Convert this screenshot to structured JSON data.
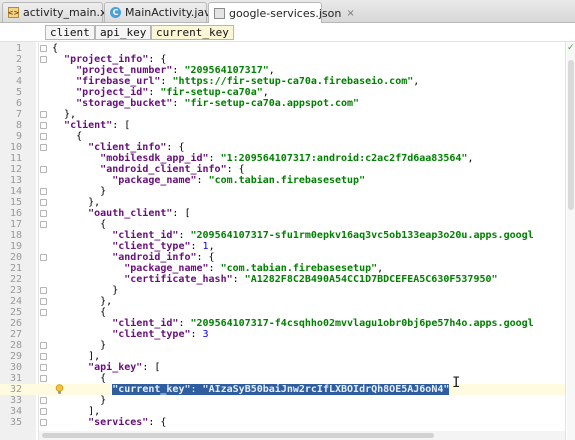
{
  "tabs": [
    {
      "label": "activity_main.xml",
      "icon": "xml-file-icon",
      "active": false
    },
    {
      "label": "MainActivity.java",
      "icon": "java-class-icon",
      "active": false
    },
    {
      "label": "google-services.json",
      "icon": "json-file-icon",
      "active": true
    }
  ],
  "tab_close_glyph": "×",
  "breadcrumb": [
    "client",
    "api_key",
    "current_key"
  ],
  "editor": {
    "lines": [
      {
        "n": "1",
        "code": "{"
      },
      {
        "n": "2",
        "code": "  \"project_info\": {"
      },
      {
        "n": "3",
        "code": "    \"project_number\": \"209564107317\","
      },
      {
        "n": "4",
        "code": "    \"firebase_url\": \"https://fir-setup-ca70a.firebaseio.com\","
      },
      {
        "n": "5",
        "code": "    \"project_id\": \"fir-setup-ca70a\","
      },
      {
        "n": "6",
        "code": "    \"storage_bucket\": \"fir-setup-ca70a.appspot.com\""
      },
      {
        "n": "7",
        "code": "  },"
      },
      {
        "n": "8",
        "code": "  \"client\": ["
      },
      {
        "n": "9",
        "code": "    {"
      },
      {
        "n": "10",
        "code": "      \"client_info\": {"
      },
      {
        "n": "11",
        "code": "        \"mobilesdk_app_id\": \"1:209564107317:android:c2ac2f7d6aa83564\","
      },
      {
        "n": "12",
        "code": "        \"android_client_info\": {"
      },
      {
        "n": "13",
        "code": "          \"package_name\": \"com.tabian.firebasesetup\""
      },
      {
        "n": "14",
        "code": "        }"
      },
      {
        "n": "15",
        "code": "      },"
      },
      {
        "n": "16",
        "code": "      \"oauth_client\": ["
      },
      {
        "n": "17",
        "code": "        {"
      },
      {
        "n": "18",
        "code": "          \"client_id\": \"209564107317-sfu1rm0epkv16aq3vc5ob133eap3o20u.apps.googl"
      },
      {
        "n": "19",
        "code": "          \"client_type\": 1,"
      },
      {
        "n": "20",
        "code": "          \"android_info\": {"
      },
      {
        "n": "21",
        "code": "            \"package_name\": \"com.tabian.firebasesetup\","
      },
      {
        "n": "22",
        "code": "            \"certificate_hash\": \"A1282F8C2B490A54CC1D7BDCEFEA5C630F537950\""
      },
      {
        "n": "23",
        "code": "          }"
      },
      {
        "n": "24",
        "code": "        },"
      },
      {
        "n": "25",
        "code": "        {"
      },
      {
        "n": "26",
        "code": "          \"client_id\": \"209564107317-f4csqhho02mvvlagu1obr0bj6pe57h4o.apps.googl"
      },
      {
        "n": "27",
        "code": "          \"client_type\": 3"
      },
      {
        "n": "28",
        "code": "        }"
      },
      {
        "n": "29",
        "code": "      ],"
      },
      {
        "n": "30",
        "code": "      \"api_key\": ["
      },
      {
        "n": "31",
        "code": "        {"
      },
      {
        "n": "32",
        "code": "          \"current_key\": \"AIzaSyB50baiJnw2rcIfLXBOIdrQh8OE5AJ6oN4\""
      },
      {
        "n": "33",
        "code": "        }"
      },
      {
        "n": "34",
        "code": "      ],"
      },
      {
        "n": "35",
        "code": "      \"services\": {"
      }
    ],
    "current_line": "32",
    "selected_line": "32",
    "fold_lines": [
      "1",
      "2",
      "7",
      "8",
      "9",
      "10",
      "12",
      "14",
      "15",
      "16",
      "17",
      "20",
      "23",
      "24",
      "25",
      "28",
      "29",
      "30",
      "31",
      "33",
      "34",
      "35"
    ]
  },
  "colors": {
    "key": "#660e7a",
    "string": "#008000",
    "number": "#0000ff",
    "selection": "#2e5e9f",
    "current_line": "#fffbe0"
  },
  "icons": [
    "xml-file-icon",
    "java-class-icon",
    "json-file-icon",
    "close-icon",
    "fold-marker-icon",
    "lightbulb-icon",
    "inspection-ok-icon",
    "text-cursor-icon"
  ],
  "status": {
    "inspection_ok": "✓",
    "cursor_glyph": "I"
  }
}
